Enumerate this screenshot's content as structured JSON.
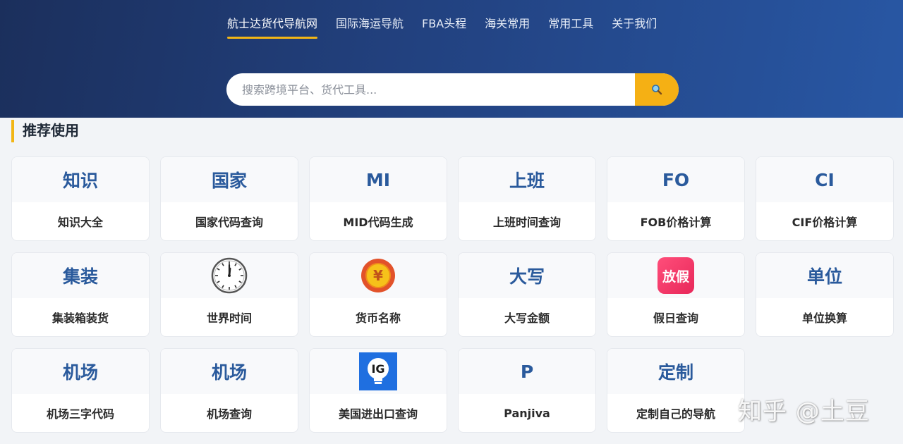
{
  "nav": {
    "items": [
      {
        "label": "航士达货代导航网",
        "active": true
      },
      {
        "label": "国际海运导航"
      },
      {
        "label": "FBA头程"
      },
      {
        "label": "海关常用"
      },
      {
        "label": "常用工具"
      },
      {
        "label": "关于我们"
      }
    ]
  },
  "search": {
    "placeholder": "搜索跨境平台、货代工具...",
    "button_icon": "search-icon"
  },
  "section": {
    "title": "推荐使用"
  },
  "cards": [
    {
      "abbr": "知识",
      "name": "知识大全"
    },
    {
      "abbr": "国家",
      "name": "国家代码查询"
    },
    {
      "abbr": "MI",
      "name": "MID代码生成"
    },
    {
      "abbr": "上班",
      "name": "上班时间查询"
    },
    {
      "abbr": "FO",
      "name": "FOB价格计算"
    },
    {
      "abbr": "CI",
      "name": "CIF价格计算"
    },
    {
      "abbr": "集装",
      "name": "集装箱装货"
    },
    {
      "icon": "clock-icon",
      "name": "世界时间"
    },
    {
      "icon": "currency-coin-icon",
      "icon_text": "¥",
      "name": "货币名称"
    },
    {
      "abbr": "大写",
      "name": "大写金额"
    },
    {
      "icon": "holiday-logo-icon",
      "icon_text": "放假",
      "name": "假日查询"
    },
    {
      "abbr": "单位",
      "name": "单位换算"
    },
    {
      "abbr": "机场",
      "name": "机场三字代码"
    },
    {
      "abbr": "机场",
      "name": "机场查询"
    },
    {
      "icon": "ig-logo-icon",
      "icon_text": "IG",
      "name": "美国进出口查询"
    },
    {
      "abbr": "P",
      "name": "Panjiva"
    },
    {
      "abbr": "定制",
      "name": "定制自己的导航"
    }
  ],
  "watermark": "知乎 @土豆",
  "colors": {
    "accent": "#f2b616",
    "header_dark": "#1b2f5c",
    "header_light": "#2857a4",
    "card_abbr": "#2a5a9c"
  }
}
